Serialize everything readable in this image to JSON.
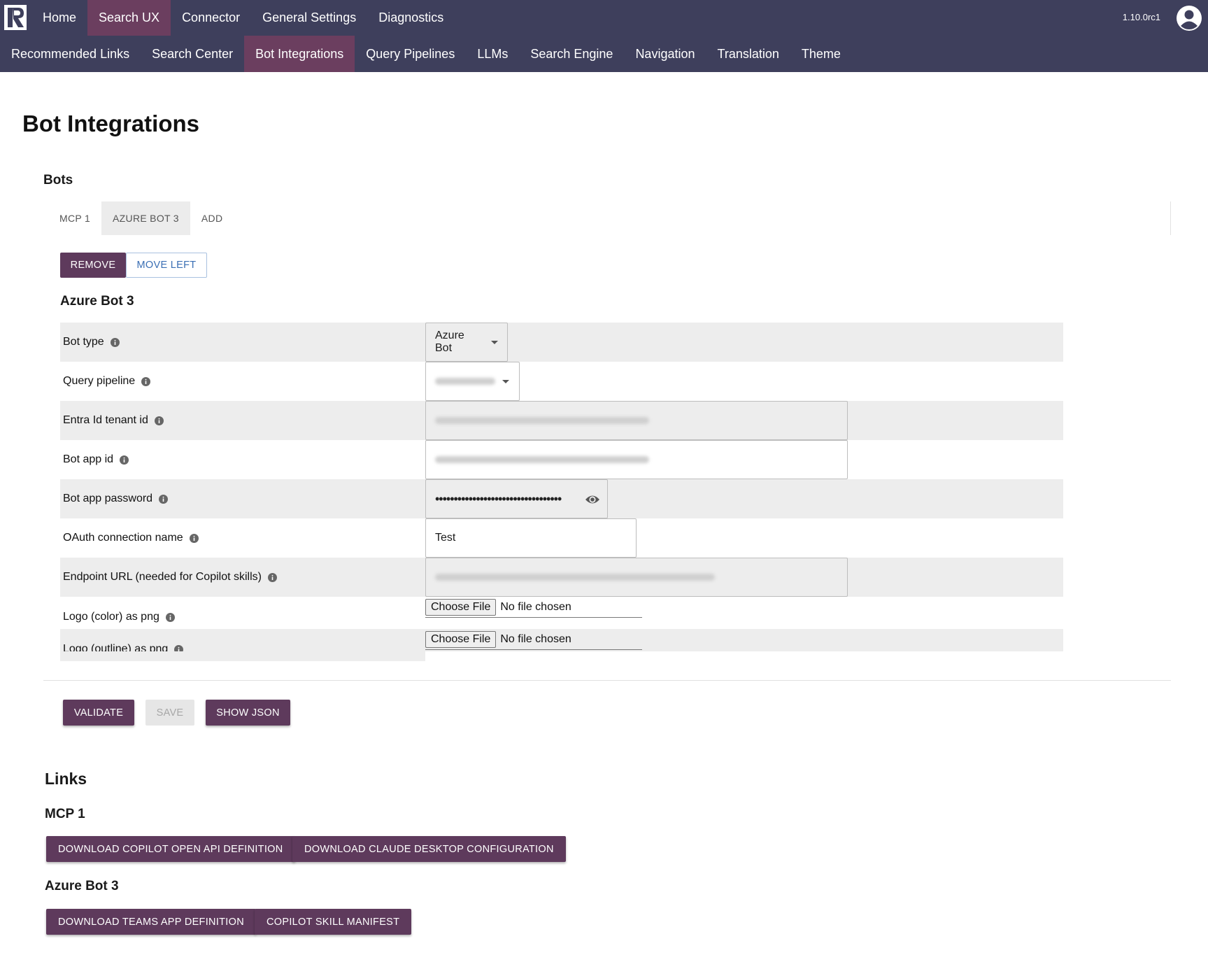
{
  "header": {
    "main_nav": [
      "Home",
      "Search UX",
      "Connector",
      "General Settings",
      "Diagnostics"
    ],
    "main_nav_active": "Search UX",
    "sub_nav": [
      "Recommended Links",
      "Search Center",
      "Bot Integrations",
      "Query Pipelines",
      "LLMs",
      "Search Engine",
      "Navigation",
      "Translation",
      "Theme"
    ],
    "sub_nav_active": "Bot Integrations",
    "version": "1.10.0rc1"
  },
  "page": {
    "title": "Bot Integrations",
    "bots_section_title": "Bots",
    "tabs": [
      "MCP 1",
      "AZURE BOT 3",
      "ADD"
    ],
    "active_tab": "AZURE BOT 3",
    "remove_label": "REMOVE",
    "move_left_label": "MOVE LEFT",
    "bot_title": "Azure Bot 3"
  },
  "form": {
    "bot_type_label": "Bot type",
    "bot_type_value": "Azure Bot",
    "query_pipeline_label": "Query pipeline",
    "entra_label": "Entra Id tenant id",
    "bot_app_id_label": "Bot app id",
    "bot_app_password_label": "Bot app password",
    "bot_app_password_value": "••••••••••••••••••••••••••••••••••",
    "oauth_label": "OAuth connection name",
    "oauth_value": "Test",
    "endpoint_label": "Endpoint URL (needed for Copilot skills)",
    "logo_color_label": "Logo (color) as png",
    "logo_outline_label": "Logo (outline) as png",
    "choose_file_label": "Choose File",
    "no_file_label": "No file chosen"
  },
  "actions": {
    "validate_label": "VALIDATE",
    "save_label": "SAVE",
    "show_json_label": "SHOW JSON"
  },
  "links": {
    "title": "Links",
    "mcp_title": "MCP 1",
    "copilot_openapi_label": "DOWNLOAD COPILOT OPEN API DEFINITION",
    "claude_config_label": "DOWNLOAD CLAUDE DESKTOP CONFIGURATION",
    "azure_title": "Azure Bot 3",
    "teams_app_label": "DOWNLOAD TEAMS APP DEFINITION",
    "copilot_skill_label": "COPILOT SKILL MANIFEST"
  },
  "colors": {
    "nav_bg": "#3e3f5c",
    "nav_active": "#6b3e5f",
    "primary_button": "#5e3a5c",
    "row_shade": "#ededed"
  },
  "icons": [
    "logo-icon",
    "user-avatar-icon",
    "info-icon",
    "eye-icon",
    "caret-down-icon"
  ]
}
